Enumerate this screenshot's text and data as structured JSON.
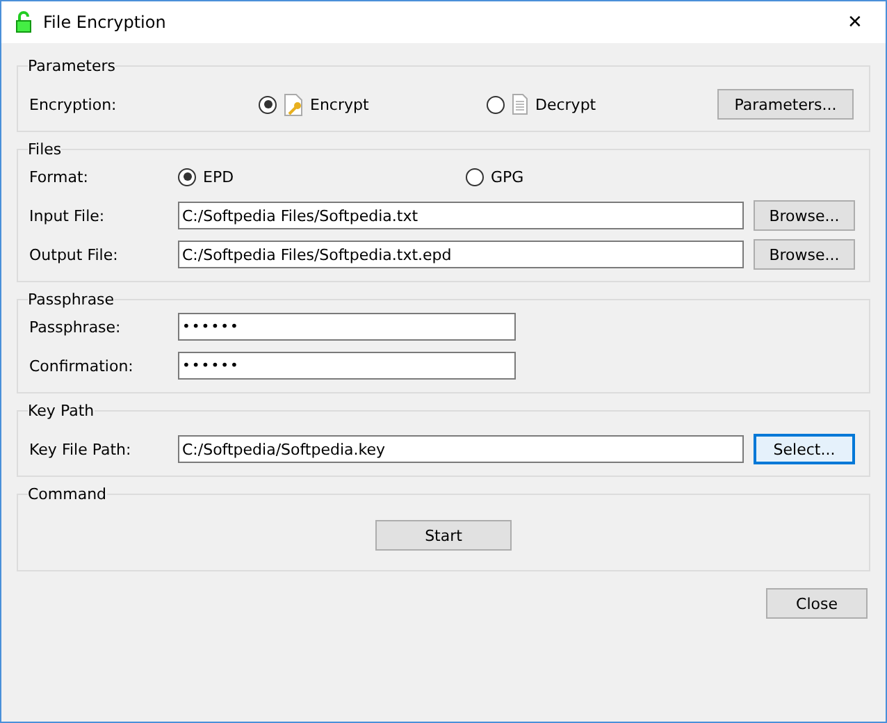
{
  "window": {
    "title": "File Encryption",
    "close": "✕"
  },
  "parameters": {
    "title": "Parameters",
    "label": "Encryption:",
    "options": [
      {
        "label": "Encrypt",
        "kind": "encrypt",
        "selected": true
      },
      {
        "label": "Decrypt",
        "kind": "decrypt",
        "selected": false
      }
    ],
    "button": "Parameters..."
  },
  "files": {
    "title": "Files",
    "format_label": "Format:",
    "formats": [
      {
        "label": "EPD",
        "selected": true
      },
      {
        "label": "GPG",
        "selected": false
      }
    ],
    "fields": [
      {
        "label": "Input File:",
        "value": "C:/Softpedia Files/Softpedia.txt",
        "button": "Browse..."
      },
      {
        "label": "Output File:",
        "value": "C:/Softpedia Files/Softpedia.txt.epd",
        "button": "Browse..."
      }
    ]
  },
  "passphrase": {
    "title": "Passphrase",
    "fields": [
      {
        "label": "Passphrase:",
        "value": "••••••"
      },
      {
        "label": "Confirmation:",
        "value": "••••••"
      }
    ]
  },
  "key_path": {
    "title": "Key Path",
    "label": "Key File Path:",
    "value": "C:/Softpedia/Softpedia.key",
    "button": "Select...",
    "button_focused": true
  },
  "command": {
    "title": "Command",
    "button": "Start"
  },
  "close_button": "Close"
}
